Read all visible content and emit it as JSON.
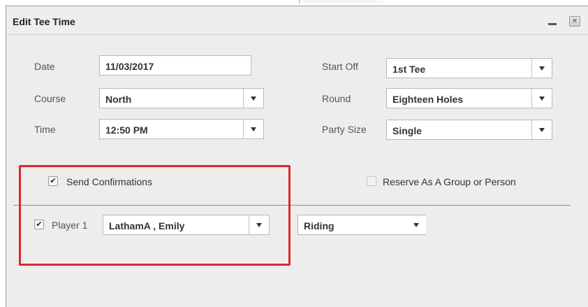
{
  "dialog": {
    "title": "Edit Tee Time",
    "close_glyph": "✕"
  },
  "form": {
    "date_label": "Date",
    "date_value": "11/03/2017",
    "course_label": "Course",
    "course_value": "North",
    "time_label": "Time",
    "time_value": "12:50 PM",
    "start_off_label": "Start Off",
    "start_off_value": "1st Tee",
    "round_label": "Round",
    "round_value": "Eighteen Holes",
    "party_size_label": "Party Size",
    "party_size_value": "Single"
  },
  "options": {
    "send_confirmations_label": "Send Confirmations",
    "send_confirmations_checked": true,
    "reserve_group_label": "Reserve As A Group or Person",
    "reserve_group_checked": false
  },
  "player": {
    "label": "Player 1",
    "checked": true,
    "name_value": "LathamA , Emily",
    "transport_value": "Riding"
  },
  "colors": {
    "highlight": "#e0262b",
    "panel": "#ededed"
  },
  "icons": {
    "checkmark": "✔",
    "dropdown": "chevron-down-icon"
  }
}
